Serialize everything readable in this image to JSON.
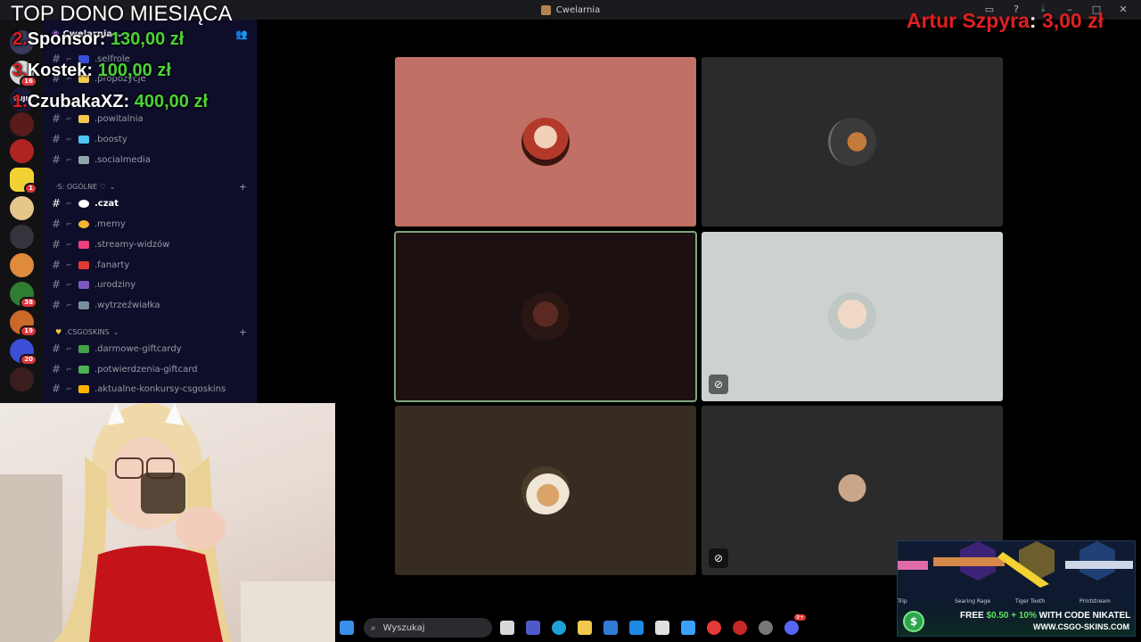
{
  "window": {
    "title": "Cwelarnia",
    "controls": [
      "inbox",
      "help",
      "download",
      "minimize",
      "maximize",
      "close"
    ]
  },
  "server_rail": {
    "badges": [
      "16",
      "1",
      "38",
      "19",
      "20"
    ]
  },
  "channel_list": {
    "guild_name": "Cwelarnia",
    "channels_top": [
      {
        "label": ".selfrole",
        "icon": "check-icon"
      },
      {
        "label": ".propozycje",
        "icon": "bulb-icon"
      },
      {
        "label": ".powitalnia",
        "icon": "wave-icon"
      },
      {
        "label": ".boosty",
        "icon": "gem-icon"
      },
      {
        "label": ".socialmedia",
        "icon": "phone-icon"
      }
    ],
    "category_general": "·S: OGÓLNE ♡",
    "channels_general": [
      {
        "label": ".czat",
        "icon": "speech-icon",
        "active": true
      },
      {
        "label": ".memy",
        "icon": "smile-icon"
      },
      {
        "label": ".streamy-widzów",
        "icon": "heart-icon"
      },
      {
        "label": ".fanarty",
        "icon": "brush-icon"
      },
      {
        "label": ".urodziny",
        "icon": "party-icon"
      },
      {
        "label": ".wytrzeźwiałka",
        "icon": "person-icon"
      }
    ],
    "category_csgo": ".CSGOSKINS",
    "channels_csgo": [
      {
        "label": ".darmowe-giftcardy",
        "icon": "money-icon"
      },
      {
        "label": ".potwierdzenia-giftcard",
        "icon": "check-box-icon"
      },
      {
        "label": ".aktualne-konkursy-csgoskins",
        "icon": "trophy-icon"
      }
    ]
  },
  "donations": {
    "header": "TOP DONO MIESIĄCA",
    "top": [
      {
        "rank": "2.",
        "name": "Sponsor: ",
        "amount": "130,00 zł"
      },
      {
        "rank": "3.",
        "name": "Kostek: ",
        "amount": "100,00 zł"
      },
      {
        "rank": "1.",
        "name": "CzubakaXZ: ",
        "amount": "400,00 zł"
      }
    ],
    "last": {
      "name": "Artur Szpyra",
      "sep": ": ",
      "amount": "3,00 zł"
    }
  },
  "video_tiles": [
    {
      "id": "tile-1",
      "bg": "#c07064",
      "muted": false,
      "speaking": false
    },
    {
      "id": "tile-2",
      "bg": "#2b2a2d",
      "muted": false,
      "speaking": false
    },
    {
      "id": "tile-3",
      "bg": "#1c1110",
      "muted": false,
      "speaking": true
    },
    {
      "id": "tile-4",
      "bg": "#ced2cf",
      "muted": true,
      "speaking": false
    },
    {
      "id": "tile-5",
      "bg": "#362c22",
      "muted": false,
      "speaking": false
    },
    {
      "id": "tile-6",
      "bg": "#2c2a2c",
      "muted": true,
      "speaking": false
    }
  ],
  "taskbar": {
    "search_placeholder": "Wyszukaj",
    "notification_badge": "9+"
  },
  "ad": {
    "skins": [
      "Trip",
      "Searing Rage",
      "Tiger Tooth",
      "Printstream"
    ],
    "promo_prefix": "FREE ",
    "promo_highlight": "$0.50 + 10%",
    "promo_suffix": " WITH CODE NIKATEL",
    "site": "WWW.CSGO-SKINS.COM"
  }
}
